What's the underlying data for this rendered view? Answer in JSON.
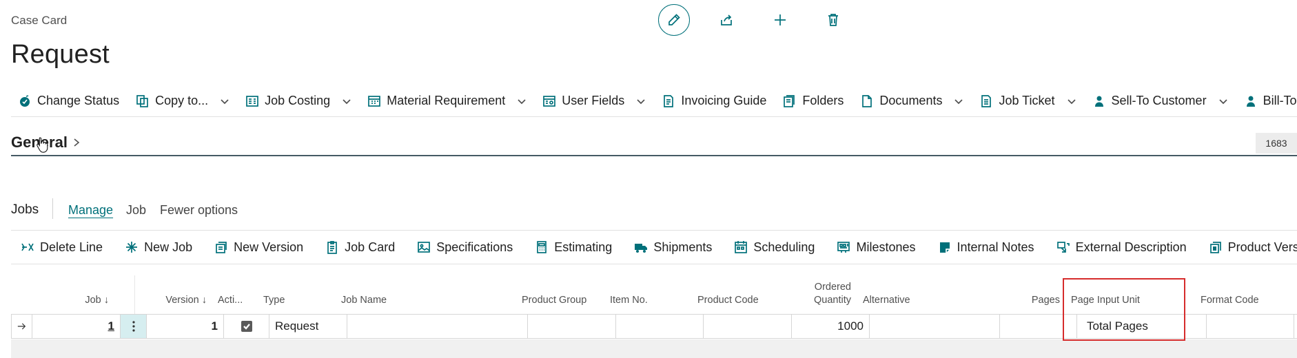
{
  "header": {
    "breadcrumb": "Case Card",
    "title": "Request",
    "buttons": [
      "edit-icon",
      "share-icon",
      "new-icon",
      "delete-icon"
    ]
  },
  "actions": {
    "change_status": "Change Status",
    "copy_to": "Copy to...",
    "job_costing": "Job Costing",
    "material_requirement": "Material Requirement",
    "user_fields": "User Fields",
    "invoicing_guide": "Invoicing Guide",
    "folders": "Folders",
    "documents": "Documents",
    "job_ticket": "Job Ticket",
    "sell_to_customer": "Sell-To Customer",
    "bill_to_customer": "Bill-To Customer"
  },
  "general": {
    "title": "General",
    "badge": "1683"
  },
  "jobs": {
    "title": "Jobs",
    "tabs": {
      "manage": "Manage",
      "job": "Job",
      "fewer": "Fewer options"
    },
    "actions": {
      "delete_line": "Delete Line",
      "new_job": "New Job",
      "new_version": "New Version",
      "job_card": "Job Card",
      "specifications": "Specifications",
      "estimating": "Estimating",
      "shipments": "Shipments",
      "scheduling": "Scheduling",
      "milestones": "Milestones",
      "internal_notes": "Internal Notes",
      "external_description": "External Description",
      "product_versions": "Product Versions"
    },
    "columns": {
      "job": "Job ↓",
      "version": "Version ↓",
      "active": "Acti...",
      "type": "Type",
      "job_name": "Job Name",
      "product_group": "Product Group",
      "item_no": "Item No.",
      "product_code": "Product Code",
      "ordered_quantity_1": "Ordered",
      "ordered_quantity_2": "Quantity",
      "alternative": "Alternative",
      "pages": "Pages",
      "page_input_unit": "Page Input Unit",
      "format_code": "Format Code"
    },
    "row": {
      "job": "1",
      "version": "1",
      "active": true,
      "type": "Request",
      "job_name": "",
      "product_group": "",
      "item_no": "",
      "product_code": "",
      "ordered_quantity": "1000",
      "alternative": "",
      "pages": "",
      "page_input_unit": "Total Pages",
      "format_code": ""
    }
  },
  "colors": {
    "accent": "#00707a",
    "highlight": "#d62b2b",
    "selected_cell": "#d6eef0"
  }
}
